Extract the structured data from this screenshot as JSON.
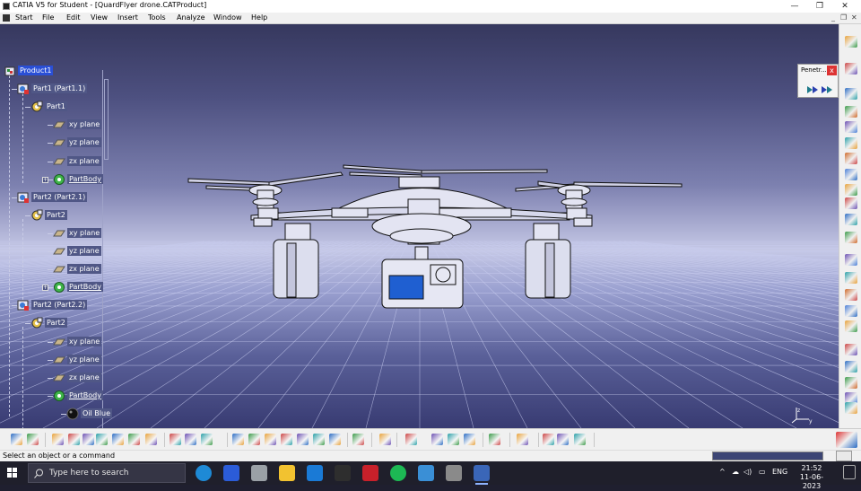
{
  "window": {
    "title": "CATIA V5 for Student - [QuardFlyer drone.CATProduct]",
    "minimize_glyph": "—",
    "restore_glyph": "❐",
    "close_glyph": "✕"
  },
  "menu": {
    "items": [
      "Start",
      "File",
      "Edit",
      "View",
      "Insert",
      "Tools",
      "Analyze",
      "Window",
      "Help"
    ],
    "mdi_controls": [
      "_",
      "❐",
      "✕"
    ]
  },
  "tree": {
    "nodes": [
      {
        "label": "Product1",
        "icon": "product-icon",
        "selected": true
      },
      {
        "label": "Part1 (Part1.1)",
        "icon": "part-instance-icon"
      },
      {
        "label": "Part1",
        "icon": "part-gear-icon"
      },
      {
        "label": "xy plane",
        "icon": "plane-icon"
      },
      {
        "label": "yz plane",
        "icon": "plane-icon"
      },
      {
        "label": "zx plane",
        "icon": "plane-icon"
      },
      {
        "label": "PartBody",
        "icon": "partbody-gear-icon",
        "expander": "+"
      },
      {
        "label": "Part2 (Part2.1)",
        "icon": "part-instance-icon"
      },
      {
        "label": "Part2",
        "icon": "part-gear-icon"
      },
      {
        "label": "xy plane",
        "icon": "plane-icon"
      },
      {
        "label": "yz plane",
        "icon": "plane-icon"
      },
      {
        "label": "zx plane",
        "icon": "plane-icon"
      },
      {
        "label": "PartBody",
        "icon": "partbody-gear-icon",
        "expander": "+"
      },
      {
        "label": "Part2 (Part2.2)",
        "icon": "part-instance-icon"
      },
      {
        "label": "Part2",
        "icon": "part-gear-icon"
      },
      {
        "label": "xy plane",
        "icon": "plane-icon"
      },
      {
        "label": "yz plane",
        "icon": "plane-icon"
      },
      {
        "label": "zx plane",
        "icon": "plane-icon"
      },
      {
        "label": "PartBody",
        "icon": "partbody-gear-icon"
      },
      {
        "label": "Oil Blue",
        "icon": "material-sphere-icon"
      }
    ]
  },
  "penetration_toolbar": {
    "title": "Penetr...",
    "close_glyph": "x",
    "buttons": [
      "penetration-start-icon",
      "penetration-end-icon"
    ]
  },
  "status": {
    "message": "Select an object or a command",
    "command_value": ""
  },
  "taskbar": {
    "search_placeholder": "Type here to search",
    "apps": [
      "edge-icon",
      "vscode-icon",
      "unity-icon",
      "file-explorer-icon",
      "skype-icon",
      "inkscape-icon",
      "sw-icon",
      "spotify-icon",
      "blue-app-icon",
      "word-icon",
      "catia-icon"
    ],
    "language": "ENG",
    "time": "21:52",
    "date": "11-06-2023",
    "tray_glyphs": [
      "^",
      "☁",
      "◁)",
      "▭"
    ]
  },
  "colors": {
    "selection": "#2a4fd6",
    "tree_label_bg": "#505786",
    "camera_screen": "#1f5fd1",
    "status_field": "#3c4574"
  },
  "right_toolbar_icons": [
    "select-arrow-icon",
    "sketch-icon",
    "product-structure-icon",
    "component-icon",
    "existing-component-icon",
    "replace-icon",
    "graph-tree-icon",
    "generate-numbering-icon",
    "bom-icon",
    "scenes-icon",
    "snap-icon",
    "constraint-icon",
    "fix-icon",
    "coincidence-icon",
    "contact-icon",
    "offset-icon",
    "angle-icon",
    "fix-together-icon",
    "reuse-pattern-icon",
    "manipulation-icon",
    "explode-icon",
    "clash-icon"
  ],
  "bottom_toolbar_icons": [
    "undo-icon",
    "redo-icon",
    "formula-icon",
    "comment-icon",
    "knowledge-icon",
    "table-icon",
    "catalog-icon",
    "measure-icon",
    "pan-icon",
    "compass-icon",
    "fit-all-icon",
    "rotate-icon",
    "zoom-in-icon",
    "zoom-out-icon",
    "normal-view-icon",
    "iso-view-icon",
    "shading-icon",
    "hide-show-icon",
    "swap-visible-icon",
    "analysis-icon",
    "catalog-browser-icon",
    "update-icon",
    "bounding-icon",
    "sectioning-icon",
    "distance-icon",
    "material-icon",
    "render-icon",
    "camera-icon",
    "layers-icon",
    "grid-icon"
  ]
}
